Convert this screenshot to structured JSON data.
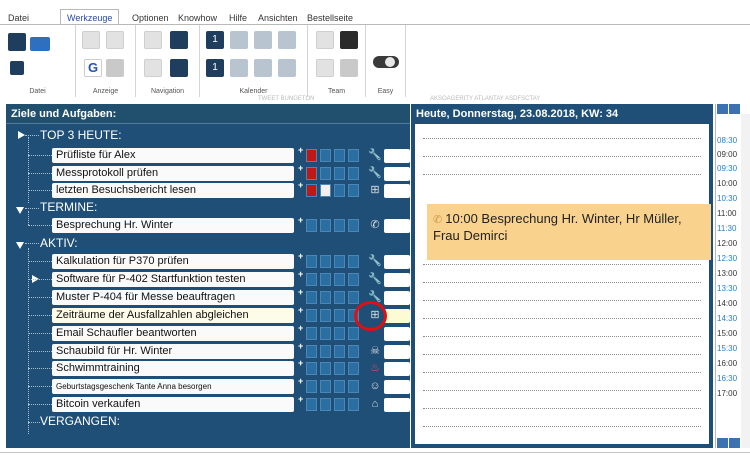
{
  "menu": [
    "Datei",
    "Werkzeuge",
    "Optionen",
    "Knowhow",
    "Hilfe",
    "Ansichten",
    "Bestellseite"
  ],
  "ribbon_groups": [
    "Datei",
    "Anzeige",
    "Navigation",
    "Kalender",
    "Team",
    "Easy"
  ],
  "ribbon_overlay": [
    "TWEET BUNGETON",
    "AKSOAGERITY ATLANTAY ASDFSCTAY"
  ],
  "left_title": "Ziele und Aufgaben:",
  "sections": [
    "TOP 3 HEUTE:",
    "TERMINE:",
    "AKTIV:",
    "VERGANGEN:"
  ],
  "tasks": [
    "Prüfliste für Alex",
    "Messprotokoll prüfen",
    "letzten Besuchsbericht lesen",
    "Besprechung Hr. Winter",
    "Kalkulation für P370 prüfen",
    "Software für P-402 Startfunktion testen",
    "Muster P-404 für Messe beauftragen",
    "Zeiträume der Ausfallzahlen abgleichen",
    "Email Schaufler beantworten",
    "Schaubild für Hr. Winter",
    "Schwimmtraining",
    "Geburtstagsgeschenk Tante Anna besorgen",
    "Bitcoin verkaufen"
  ],
  "plus": "+",
  "date_header": "Heute, Donnerstag, 23.08.2018, KW: 34",
  "appointment": "10:00 Besprechung Hr. Winter, Hr Müller, Frau Demirci",
  "times": [
    "08:30",
    "09:00",
    "09:30",
    "10:00",
    "10:30",
    "11:00",
    "11:30",
    "12:00",
    "12:30",
    "13:00",
    "13:30",
    "14:00",
    "14:30",
    "15:00",
    "15:30",
    "16:00",
    "16:30",
    "17:00"
  ],
  "icons": {
    "save": "save-icon",
    "appointment": "phone-icon",
    "toggle": "easy-toggle"
  }
}
